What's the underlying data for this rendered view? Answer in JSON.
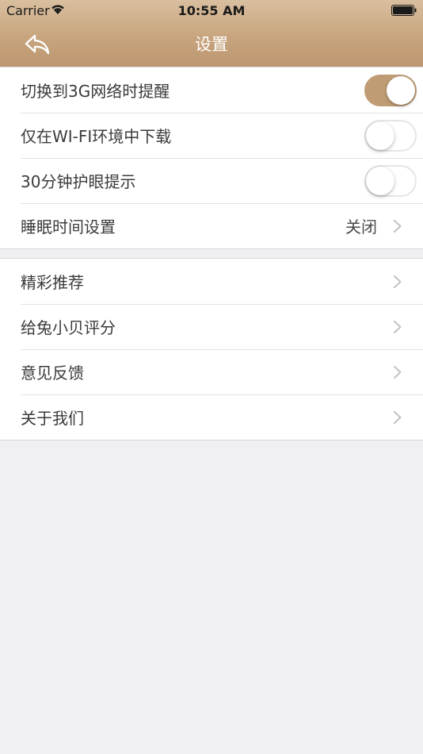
{
  "status_bar": {
    "carrier": "Carrier",
    "time": "10:55 AM"
  },
  "navbar": {
    "title": "设置",
    "back_icon": "back-arrow-icon"
  },
  "groups": [
    {
      "rows": [
        {
          "label": "切换到3G网络时提醒",
          "control": "toggle",
          "on": true
        },
        {
          "label": "仅在WI-FI环境中下载",
          "control": "toggle",
          "on": false
        },
        {
          "label": "30分钟护眼提示",
          "control": "toggle",
          "on": false
        },
        {
          "label": "睡眠时间设置",
          "control": "disclosure",
          "value": "关闭"
        }
      ]
    },
    {
      "rows": [
        {
          "label": "精彩推荐",
          "control": "disclosure"
        },
        {
          "label": "给兔小贝评分",
          "control": "disclosure"
        },
        {
          "label": "意见反馈",
          "control": "disclosure"
        },
        {
          "label": "关于我们",
          "control": "disclosure"
        }
      ]
    }
  ],
  "colors": {
    "header_top": "#d9bf9f",
    "header_bottom": "#bc9670",
    "toggle_on": "#bf9c74",
    "background": "#efeff4"
  }
}
